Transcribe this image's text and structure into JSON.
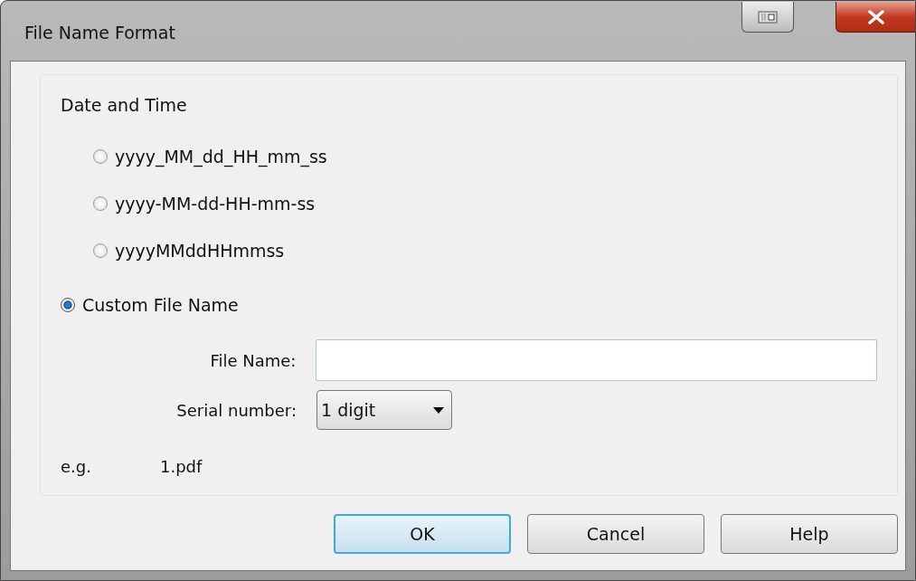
{
  "window": {
    "title": "File Name Format"
  },
  "section_label": "Date and Time",
  "formats": [
    {
      "label": "yyyy_MM_dd_HH_mm_ss",
      "selected": false,
      "kind": "preset"
    },
    {
      "label": "yyyy-MM-dd-HH-mm-ss",
      "selected": false,
      "kind": "preset"
    },
    {
      "label": "yyyyMMddHHmmss",
      "selected": false,
      "kind": "preset"
    },
    {
      "label": "Custom File Name",
      "selected": true,
      "kind": "custom"
    }
  ],
  "file_name": {
    "label": "File Name:"
  },
  "serial_number": {
    "label": "Serial number:",
    "value": "1 digit"
  },
  "example": {
    "label": "e.g.",
    "value": "1.pdf"
  },
  "buttons": [
    {
      "label": "OK",
      "default": true
    },
    {
      "label": "Cancel",
      "default": false
    },
    {
      "label": "Help",
      "default": false
    }
  ]
}
